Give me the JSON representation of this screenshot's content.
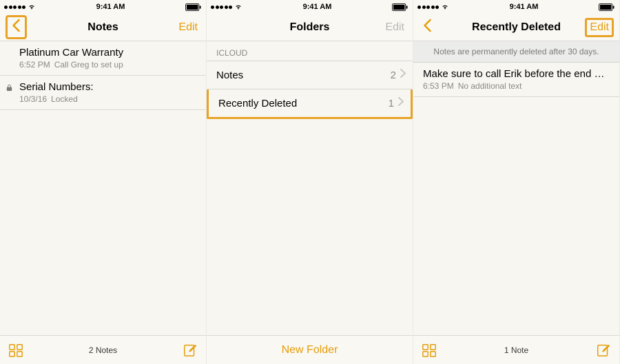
{
  "status": {
    "time": "9:41 AM"
  },
  "screen1": {
    "title": "Notes",
    "edit": "Edit",
    "items": [
      {
        "title": "Platinum Car Warranty",
        "time": "6:52 PM",
        "preview": "Call Greg to set up",
        "locked": false
      },
      {
        "title": "Serial Numbers:",
        "time": "10/3/16",
        "preview": "Locked",
        "locked": true
      }
    ],
    "footer_count": "2 Notes"
  },
  "screen2": {
    "title": "Folders",
    "edit": "Edit",
    "section": "ICLOUD",
    "folders": [
      {
        "name": "Notes",
        "count": "2"
      },
      {
        "name": "Recently Deleted",
        "count": "1"
      }
    ],
    "new_folder": "New Folder"
  },
  "screen3": {
    "title": "Recently Deleted",
    "edit": "Edit",
    "banner": "Notes are permanently deleted after 30 days.",
    "items": [
      {
        "title": "Make sure to call Erik before the end of the n...",
        "time": "6:53 PM",
        "preview": "No additional text"
      }
    ],
    "footer_count": "1 Note"
  }
}
